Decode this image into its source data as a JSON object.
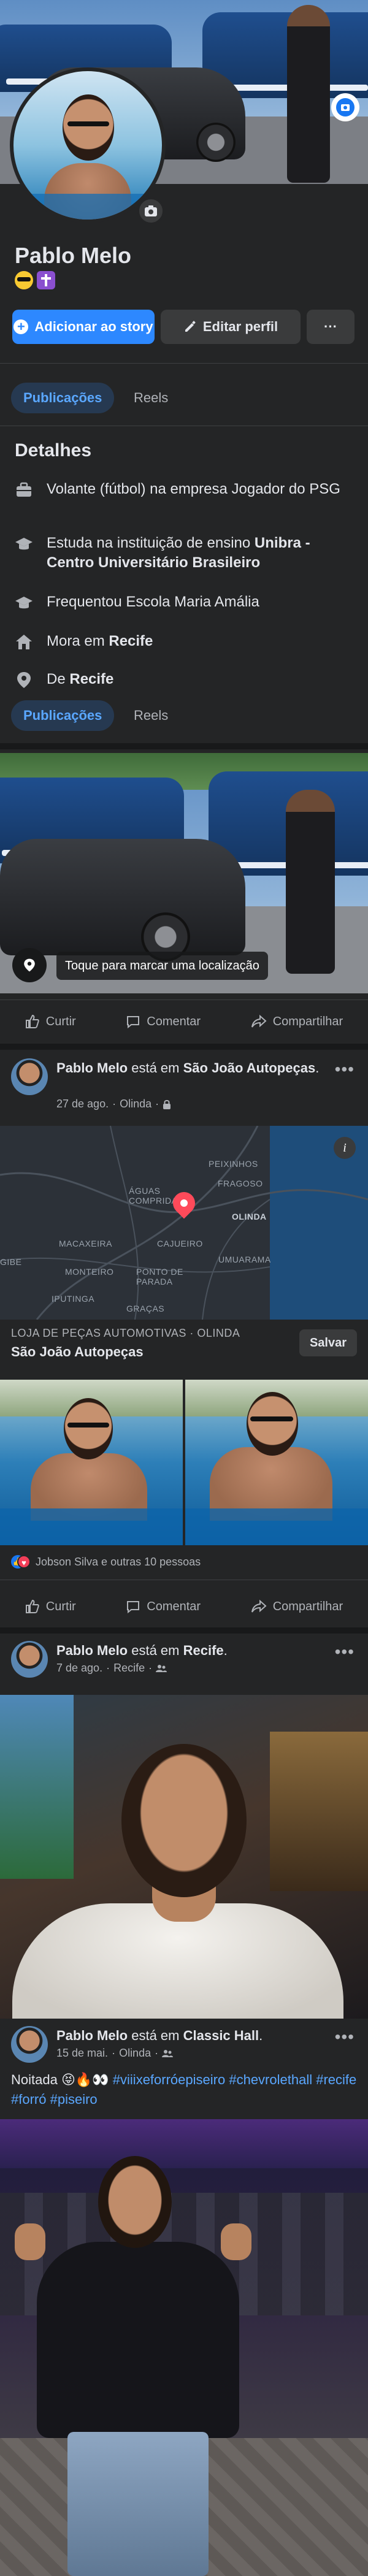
{
  "profile": {
    "name": "Pablo Melo",
    "story_button": "Adicionar ao story",
    "edit_button": "Editar perfil",
    "more_button": "···"
  },
  "tabs": {
    "posts": "Publicações",
    "reels": "Reels"
  },
  "details": {
    "title": "Detalhes",
    "work": {
      "pre": "Volante (fútbol) na empresa Jogador do PSG"
    },
    "study": {
      "pre": "Estuda na instituição de ensino ",
      "bold": "Unibra - Centro Universitário Brasileiro"
    },
    "school": {
      "pre": "Frequentou Escola Maria Amália"
    },
    "lives": {
      "pre": "Mora em ",
      "bold": "Recife"
    },
    "from": {
      "pre": "De ",
      "bold": "Recife"
    }
  },
  "photo_post": {
    "location_prompt": "Toque para marcar uma localização"
  },
  "actions": {
    "like": "Curtir",
    "comment": "Comentar",
    "share": "Compartilhar"
  },
  "post1": {
    "author": "Pablo Melo",
    "verb": " está em ",
    "place": "São João Autopeças",
    "date": "27 de ago.",
    "city": "Olinda",
    "map_labels": [
      "FRAGOSO",
      "ÁGUAS COMPRIDAS",
      "OLINDA",
      "MACAXEIRA",
      "CAJUEIRO",
      "UMUARAMA",
      "GIBE",
      "MONTEIRO",
      "PONTO DE PARADA",
      "IPUTINGA",
      "GRAÇAS",
      "PEIXINHOS"
    ],
    "place_category": "LOJA DE PEÇAS AUTOMOTIVAS · OLINDA",
    "place_name": "São João Autopeças",
    "save": "Salvar",
    "reactions": "Jobson Silva e outras 10 pessoas"
  },
  "post2": {
    "author": "Pablo Melo",
    "verb": " está em ",
    "place": "Recife",
    "date": "7 de ago.",
    "city": "Recife"
  },
  "post3": {
    "author": "Pablo Melo",
    "verb": " está em ",
    "place": "Classic Hall",
    "date": "15 de mai.",
    "city": "Olinda",
    "caption_text": "Noitada 😝🔥👀",
    "hashtags": [
      "#viiixeforróepiseiro",
      "#chevrolethall",
      "#recife",
      "#forró",
      "#piseiro"
    ]
  },
  "colors": {
    "background": "#242526",
    "accent": "#2d88ff",
    "tab_active_bg": "#263951",
    "link": "#5aa7ff"
  }
}
